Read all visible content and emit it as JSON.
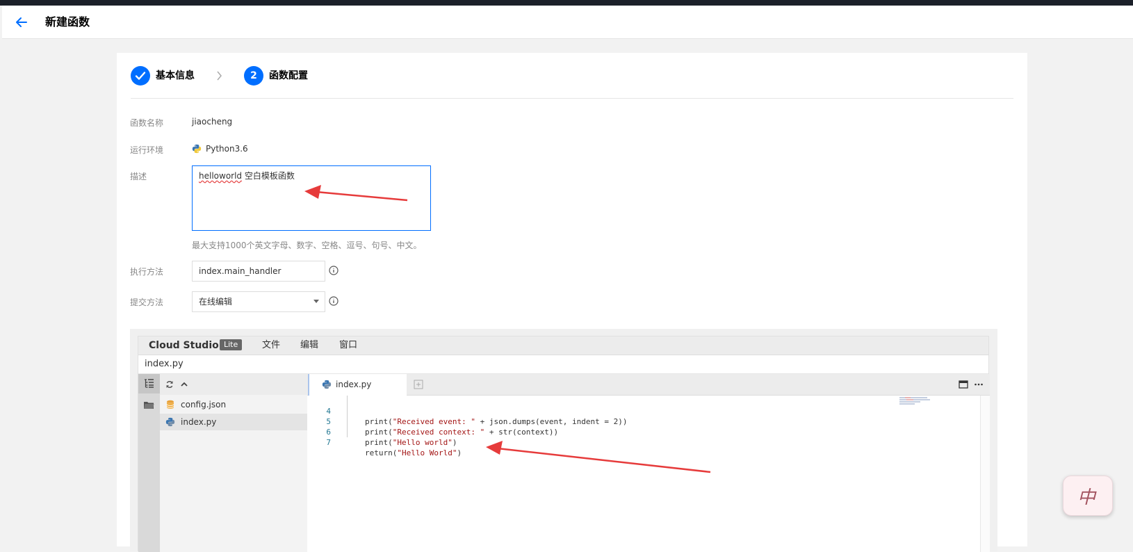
{
  "header": {
    "title": "新建函数"
  },
  "steps": [
    {
      "label": "基本信息",
      "state": "done"
    },
    {
      "number": "2",
      "label": "函数配置",
      "state": "active"
    }
  ],
  "form": {
    "name": {
      "label": "函数名称",
      "value": "jiaocheng"
    },
    "runtime": {
      "label": "运行环境",
      "value": "Python3.6",
      "icon": "python-icon"
    },
    "description": {
      "label": "描述",
      "value_word": "helloworld",
      "value_rest": " 空白模板函数",
      "hint": "最大支持1000个英文字母、数字、空格、逗号、句号、中文。"
    },
    "handler": {
      "label": "执行方法",
      "value": "index.main_handler"
    },
    "submit": {
      "label": "提交方法",
      "value": "在线编辑"
    }
  },
  "ide": {
    "brand": "Cloud Studio",
    "badge": "Lite",
    "menu": [
      "文件",
      "编辑",
      "窗口"
    ],
    "path": "index.py",
    "files": [
      {
        "name": "config.json",
        "icon": "database-icon"
      },
      {
        "name": "index.py",
        "icon": "python-icon",
        "selected": true
      }
    ],
    "active_tab": "index.py",
    "code": [
      {
        "line": "4",
        "prefix": "print(",
        "string": "\"Received event: \"",
        "suffix": " + json.dumps(event, indent = 2))"
      },
      {
        "line": "5",
        "prefix": "print(",
        "string": "\"Received context: \"",
        "suffix": " + str(context))"
      },
      {
        "line": "6",
        "prefix": "print(",
        "string": "\"Hello world\"",
        "suffix": ")"
      },
      {
        "line": "7",
        "prefix": "return(",
        "string": "\"Hello World\"",
        "suffix": ")"
      }
    ]
  },
  "ime": {
    "char": "中"
  },
  "colors": {
    "primary": "#006eff",
    "annotation_arrow": "#e63b3b"
  }
}
